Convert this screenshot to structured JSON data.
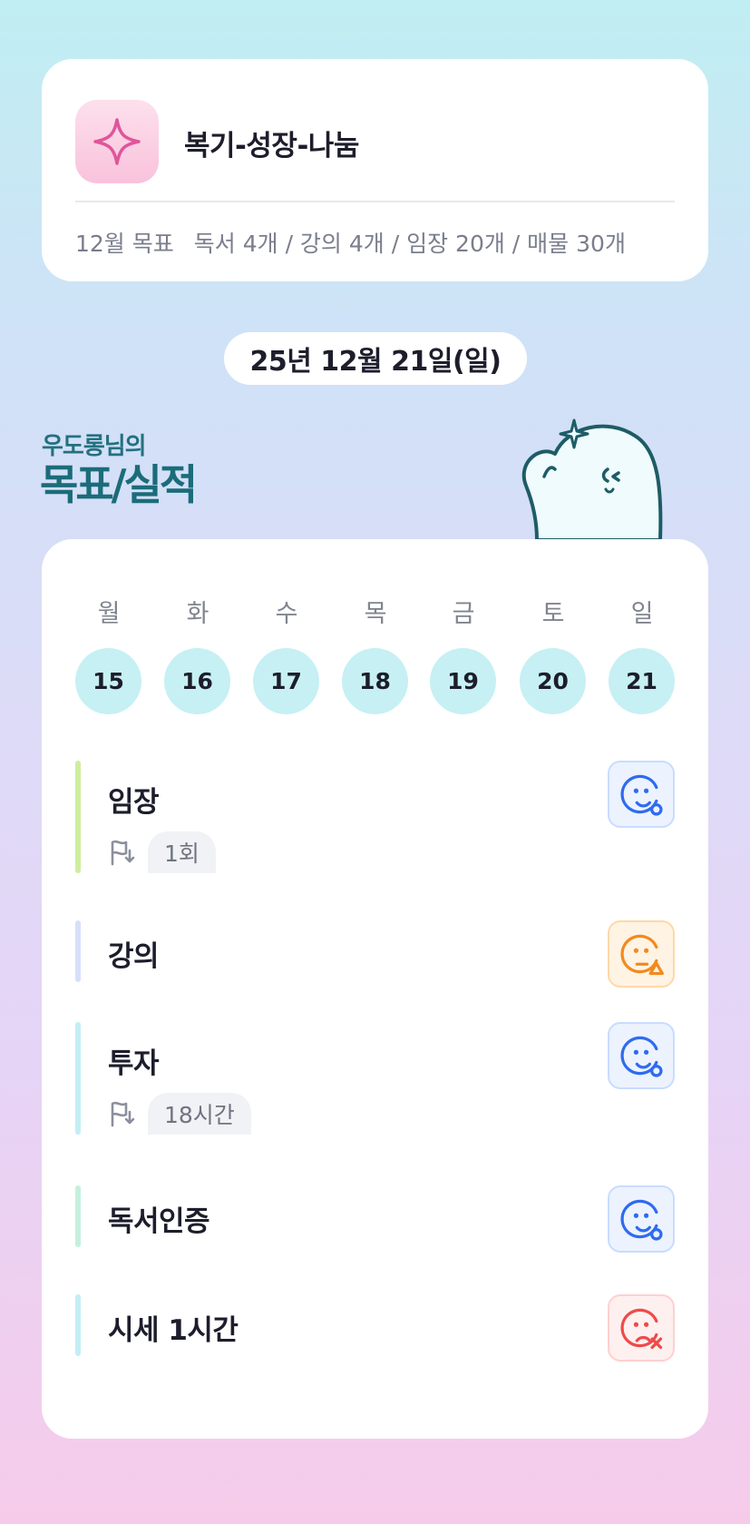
{
  "header": {
    "group_name": "복기-성장-나눔",
    "goal_label": "12월 목표",
    "goal_text": "독서 4개 / 강의 4개 / 임장 20개 / 매물 30개"
  },
  "date": "25년 12월 21일(일)",
  "title": {
    "sub": "우도롱님의",
    "main": "목표/실적"
  },
  "week": [
    {
      "name": "월",
      "num": "15"
    },
    {
      "name": "화",
      "num": "16"
    },
    {
      "name": "수",
      "num": "17"
    },
    {
      "name": "목",
      "num": "18"
    },
    {
      "name": "금",
      "num": "19"
    },
    {
      "name": "토",
      "num": "20"
    },
    {
      "name": "일",
      "num": "21"
    }
  ],
  "tasks": [
    {
      "name": "임장",
      "meta": "1회",
      "status": "good",
      "bar_color": "#cdeea0"
    },
    {
      "name": "강의",
      "status": "warn",
      "bar_color": "#d7e0fb"
    },
    {
      "name": "투자",
      "meta": "18시간",
      "status": "good",
      "bar_color": "#c2eff4"
    },
    {
      "name": "독서인증",
      "status": "good",
      "bar_color": "#c4f0dd"
    },
    {
      "name": "시세 1시간",
      "status": "bad",
      "bar_color": "#c2eff4"
    }
  ],
  "colors": {
    "good_icon": "#2f6bef",
    "warn_icon": "#f28a1e",
    "bad_icon": "#ef4a4a",
    "title_teal": "#1b6c7a"
  },
  "icons": {
    "logo": "sparkle-icon",
    "meta": "flag-icon"
  }
}
